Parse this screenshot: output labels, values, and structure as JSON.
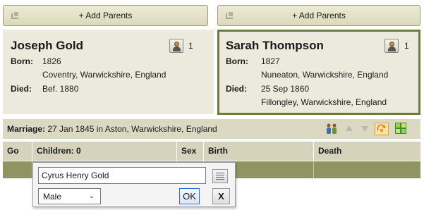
{
  "father_add_parents_label": "+ Add Parents",
  "mother_add_parents_label": "+ Add Parents",
  "father": {
    "name": "Joseph Gold",
    "count": "1",
    "born_label": "Born:",
    "born_date": "1826",
    "born_place": "Coventry, Warwickshire, England",
    "died_label": "Died:",
    "died_date": "Bef. 1880"
  },
  "mother": {
    "name": "Sarah Thompson",
    "count": "1",
    "born_label": "Born:",
    "born_date": "1827",
    "born_place": "Nuneaton, Warwickshire, England",
    "died_label": "Died:",
    "died_date": "25 Sep 1860",
    "died_place": "Fillongley, Warwickshire, England"
  },
  "marriage": {
    "label": "Marriage:",
    "text": "27 Jan 1845 in Aston, Warwickshire, England"
  },
  "children_table": {
    "columns": [
      "Go",
      "Children: 0",
      "Sex",
      "Birth",
      "Death"
    ]
  },
  "editor": {
    "name_value": "Cyrus Henry Gold",
    "sex_value": "Male",
    "ok_label": "OK",
    "cancel_label": "X"
  },
  "colors": {
    "selected_border": "#6b7d3c",
    "row_highlight": "#8f9562",
    "panel_bg": "#eceadc"
  },
  "icons": [
    "grip-icon",
    "person-icon",
    "couple-icon",
    "arrow-up-icon",
    "arrow-down-icon",
    "sort-icon",
    "grid-icon",
    "notes-icon",
    "chevron-down-icon"
  ]
}
